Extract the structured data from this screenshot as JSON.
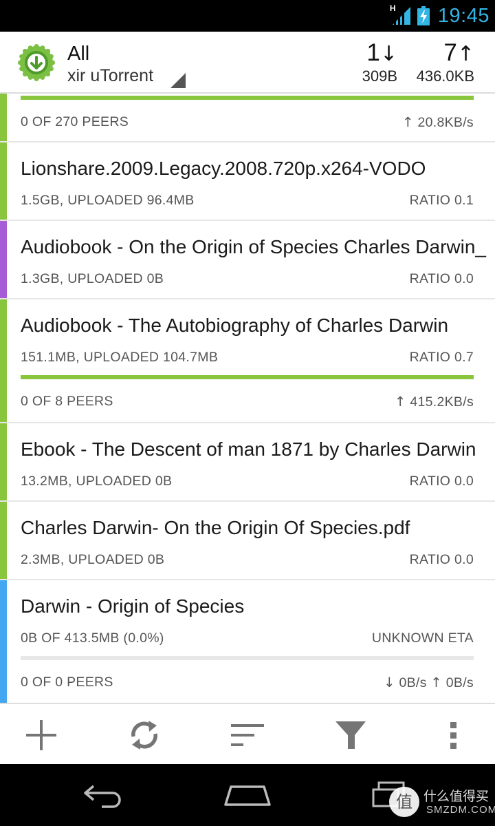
{
  "status_bar": {
    "time": "19:45",
    "network_type": "H",
    "icons": [
      "signal-icon",
      "battery-charging-icon"
    ]
  },
  "header": {
    "title": "All",
    "subtitle": "xir uTorrent",
    "download": {
      "count": "1",
      "arrow": "↓",
      "speed": "309B"
    },
    "upload": {
      "count": "7",
      "arrow": "↑",
      "speed": "436.0KB"
    }
  },
  "colors": {
    "seeding": "#8ac53e",
    "paused": "#a65cd6",
    "downloading": "#43a7f2",
    "accent": "#33b5e5"
  },
  "torrents": [
    {
      "name": "",
      "status": "seeding",
      "progress": 1.0,
      "meta_left": "",
      "meta_right": "",
      "peers": "0 OF 270 PEERS",
      "speed": "20.8KB/s",
      "speed_arrow": "↑"
    },
    {
      "name": "Lionshare.2009.Legacy.2008.720p.x264-VODO",
      "status": "seeding",
      "meta_left": "1.5GB, UPLOADED 96.4MB",
      "meta_right": "RATIO 0.1"
    },
    {
      "name": "Audiobook - On the Origin of Species  Charles Darwin_",
      "status": "paused",
      "meta_left": "1.3GB, UPLOADED 0B",
      "meta_right": "RATIO 0.0"
    },
    {
      "name": "Audiobook - The Autobiography of Charles Darwin",
      "status": "seeding",
      "meta_left": "151.1MB, UPLOADED 104.7MB",
      "meta_right": "RATIO 0.7",
      "progress": 1.0,
      "peers": "0 OF 8 PEERS",
      "speed": "415.2KB/s",
      "speed_arrow": "↑"
    },
    {
      "name": "Ebook - The Descent of man 1871 by Charles Darwin",
      "status": "seeding",
      "meta_left": "13.2MB, UPLOADED 0B",
      "meta_right": "RATIO 0.0"
    },
    {
      "name": "Charles Darwin- On the Origin Of Species.pdf",
      "status": "seeding",
      "meta_left": "2.3MB, UPLOADED 0B",
      "meta_right": "RATIO 0.0"
    },
    {
      "name": "Darwin - Origin of Species",
      "status": "downloading",
      "meta_left": "0B OF 413.5MB (0.0%)",
      "meta_right": "UNKNOWN ETA",
      "progress": 0.0,
      "peers": "0 OF 0 PEERS",
      "down_speed": "0B/s",
      "down_arrow": "↓",
      "speed": "0B/s",
      "speed_arrow": "↑"
    }
  ],
  "bottom_bar": [
    "add-icon",
    "refresh-icon",
    "sort-icon",
    "filter-icon",
    "overflow-menu-icon"
  ],
  "nav_bar": [
    "back-icon",
    "home-icon",
    "recent-apps-icon"
  ],
  "watermark": {
    "line1": "什么值得买",
    "line2": "SMZDM.COM",
    "badge": "值"
  }
}
